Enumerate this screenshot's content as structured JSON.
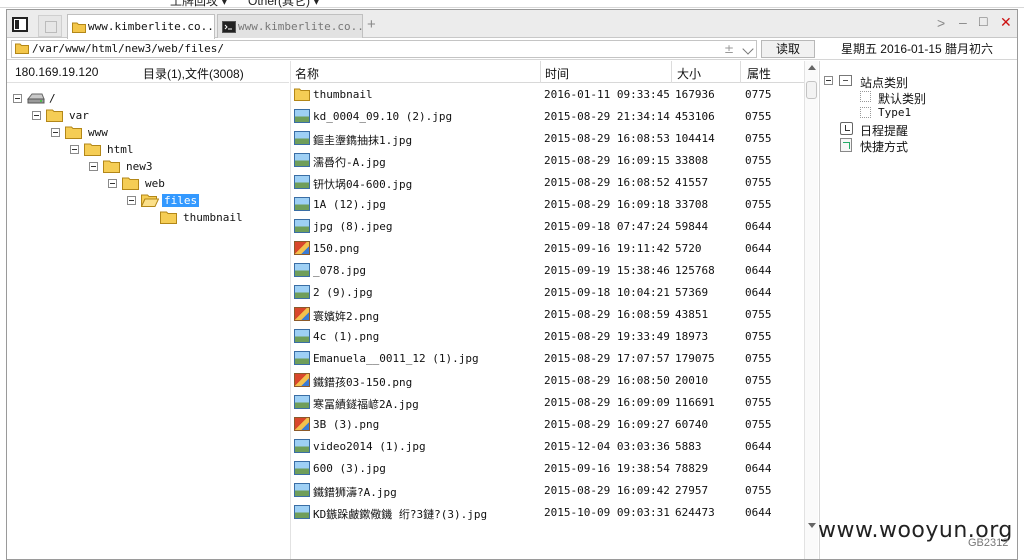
{
  "topstrip": {
    "left_text": "土牌回攻 ▾",
    "mid_text": "Other(其它) ▾"
  },
  "tabs": [
    {
      "title": "www.kimberlite.co...",
      "type": "folder",
      "active": true
    },
    {
      "title": "www.kimberlite.co...",
      "type": "terminal",
      "active": false
    }
  ],
  "tab_add_label": "+",
  "window_controls": {
    "next": ">",
    "minimize": "–",
    "maximize": "□",
    "close": "✕"
  },
  "address": {
    "path": "/var/www/html/new3/web/files/",
    "plusminus": "±",
    "read_label": "读取"
  },
  "date_info": "星期五 2016-01-15 腊月初六",
  "left_header": {
    "ip": "180.169.19.120",
    "counts": "目录(1),文件(3008)"
  },
  "tree": [
    {
      "label": "/",
      "depth": 0,
      "type": "drive",
      "selected": false
    },
    {
      "label": "var",
      "depth": 1,
      "type": "folder",
      "selected": false
    },
    {
      "label": "www",
      "depth": 2,
      "type": "folder",
      "selected": false
    },
    {
      "label": "html",
      "depth": 3,
      "type": "folder",
      "selected": false
    },
    {
      "label": "new3",
      "depth": 4,
      "type": "folder",
      "selected": false
    },
    {
      "label": "web",
      "depth": 5,
      "type": "folder",
      "selected": false
    },
    {
      "label": "files",
      "depth": 6,
      "type": "folder",
      "selected": true
    },
    {
      "label": "thumbnail",
      "depth": 7,
      "type": "folder",
      "selected": false,
      "leaf": true
    }
  ],
  "list": {
    "headers": {
      "name": "名称",
      "time": "时间",
      "size": "大小",
      "attr": "属性"
    },
    "rows": [
      {
        "icon": "folder",
        "name": "thumbnail",
        "time": "2016-01-11 09:33:45",
        "size": "167936",
        "attr": "0775"
      },
      {
        "icon": "image",
        "name": "kd_0004_09.10 (2).jpg",
        "time": "2015-08-29 21:34:14",
        "size": "453106",
        "attr": "0755"
      },
      {
        "icon": "image",
        "name": "鏂圭塰鐫抽抹1.jpg",
        "time": "2015-08-29 16:08:53",
        "size": "104414",
        "attr": "0755"
      },
      {
        "icon": "image",
        "name": "濡噕彴-A.jpg",
        "time": "2015-08-29 16:09:15",
        "size": "33808",
        "attr": "0755"
      },
      {
        "icon": "image",
        "name": "钘忕埚04-600.jpg",
        "time": "2015-08-29 16:08:52",
        "size": "41557",
        "attr": "0755"
      },
      {
        "icon": "image",
        "name": "1A (12).jpg",
        "time": "2015-08-29 16:09:18",
        "size": "33708",
        "attr": "0755"
      },
      {
        "icon": "image",
        "name": "jpg (8).jpeg",
        "time": "2015-09-18 07:47:24",
        "size": "59844",
        "attr": "0644"
      },
      {
        "icon": "png",
        "name": "150.png",
        "time": "2015-09-16 19:11:42",
        "size": "5720",
        "attr": "0644"
      },
      {
        "icon": "image",
        "name": "_078.jpg",
        "time": "2015-09-19 15:38:46",
        "size": "125768",
        "attr": "0644"
      },
      {
        "icon": "image",
        "name": "2 (9).jpg",
        "time": "2015-09-18 10:04:21",
        "size": "57369",
        "attr": "0644"
      },
      {
        "icon": "png",
        "name": "寰嬪姩2.png",
        "time": "2015-08-29 16:08:59",
        "size": "43851",
        "attr": "0755"
      },
      {
        "icon": "image",
        "name": "4c (1).png",
        "time": "2015-08-29 19:33:49",
        "size": "18973",
        "attr": "0755"
      },
      {
        "icon": "image",
        "name": "Emanuela__0011_12 (1).jpg",
        "time": "2015-08-29 17:07:57",
        "size": "179075",
        "attr": "0755"
      },
      {
        "icon": "png",
        "name": "鐵鐠孩03-150.png",
        "time": "2015-08-29 16:08:50",
        "size": "20010",
        "attr": "0755"
      },
      {
        "icon": "image",
        "name": "寒冨績鐩福嵃2A.jpg",
        "time": "2015-08-29 16:09:09",
        "size": "116691",
        "attr": "0755"
      },
      {
        "icon": "png",
        "name": "3B (3).png",
        "time": "2015-08-29 16:09:27",
        "size": "60740",
        "attr": "0755"
      },
      {
        "icon": "image",
        "name": "video2014 (1).jpg",
        "time": "2015-12-04 03:03:36",
        "size": "5883",
        "attr": "0644"
      },
      {
        "icon": "image",
        "name": "600 (3).jpg",
        "time": "2015-09-16 19:38:54",
        "size": "78829",
        "attr": "0644"
      },
      {
        "icon": "image",
        "name": "鐵鐠狮濤?A.jpg",
        "time": "2015-08-29 16:09:42",
        "size": "27957",
        "attr": "0755"
      },
      {
        "icon": "image",
        "name": "KD鏃跺皻鏉儆鐖 绗?3鏈?(3).jpg",
        "time": "2015-10-09 09:03:31",
        "size": "624473",
        "attr": "0644"
      }
    ]
  },
  "right_panel": {
    "site_category": "站点类别",
    "default_category": "默认类别",
    "type1": "Type1",
    "schedule": "日程提醒",
    "shortcuts": "快捷方式"
  },
  "watermark": {
    "text": "www.wooyun.org",
    "sub": "GB2312"
  }
}
